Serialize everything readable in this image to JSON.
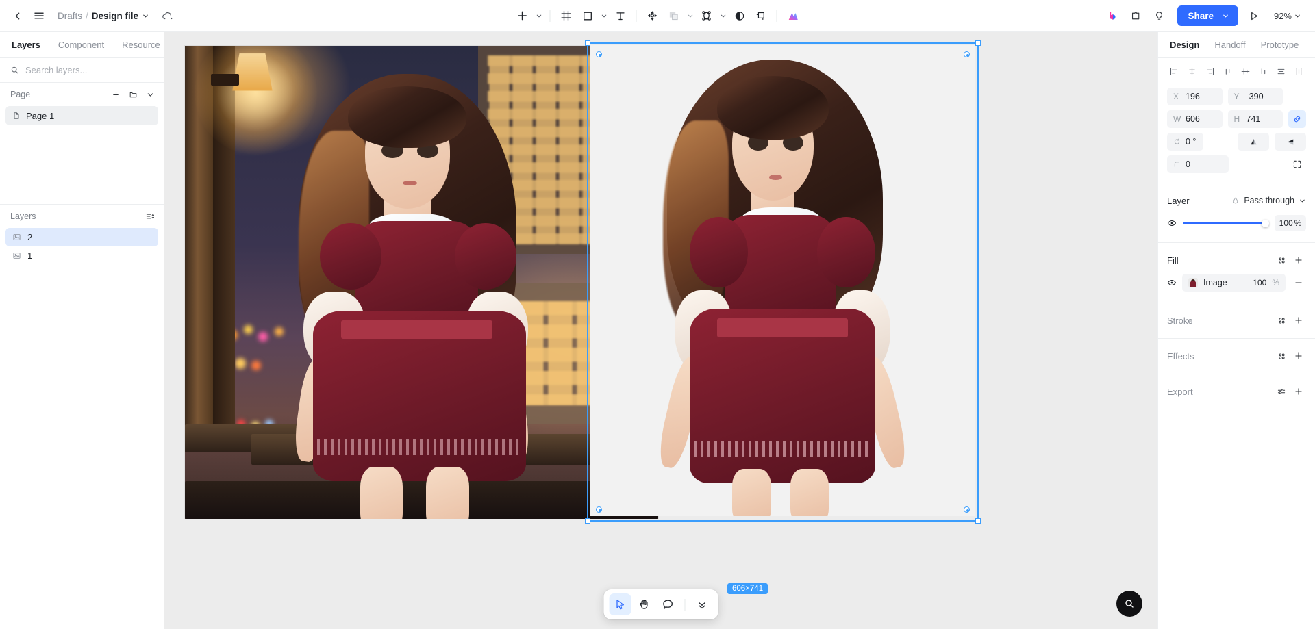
{
  "topbar": {
    "back_icon": "chevron-left-icon",
    "menu_icon": "hamburger-menu-icon",
    "breadcrumb": {
      "root": "Drafts",
      "separator": "/",
      "file": "Design file"
    },
    "cloud_icon": "cloud-saved-icon",
    "tools": [
      {
        "name": "add-icon",
        "has_caret": true
      },
      {
        "name": "frame-icon",
        "has_caret": false
      },
      {
        "name": "rectangle-icon",
        "has_caret": true
      },
      {
        "name": "text-icon",
        "has_caret": false
      },
      {
        "name": "move-transform-icon",
        "has_caret": false
      },
      {
        "name": "boolean-union-icon",
        "has_caret": true
      },
      {
        "name": "vector-node-icon",
        "has_caret": true
      },
      {
        "name": "contrast-icon",
        "has_caret": false
      },
      {
        "name": "crop-icon",
        "has_caret": false
      },
      {
        "name": "ai-magic-icon",
        "has_caret": false
      }
    ],
    "right": {
      "brand_icon": "brand-b-icon",
      "plugin_icon": "plugin-puzzle-icon",
      "idea_icon": "lightbulb-icon",
      "share_label": "Share",
      "share_caret_icon": "chevron-down-icon",
      "present_icon": "play-present-icon",
      "zoom_label": "92%",
      "zoom_caret_icon": "chevron-down-icon"
    },
    "accent_color": "#2f6bff"
  },
  "left_panel": {
    "tabs": [
      {
        "label": "Layers",
        "active": true
      },
      {
        "label": "Component",
        "active": false
      },
      {
        "label": "Resource",
        "active": false
      }
    ],
    "search": {
      "placeholder": "Search layers...",
      "value": "",
      "icon": "search-icon"
    },
    "page_section": {
      "title": "Page",
      "actions": [
        "plus-icon",
        "folder-icon",
        "chevron-down-icon"
      ],
      "items": [
        {
          "label": "Page 1",
          "icon": "page-file-icon",
          "selected": true
        }
      ]
    },
    "layers_section": {
      "title": "Layers",
      "sort_icon": "sort-list-icon",
      "items": [
        {
          "label": "2",
          "icon": "image-layer-icon",
          "selected": true
        },
        {
          "label": "1",
          "icon": "image-layer-icon",
          "selected": false
        }
      ]
    }
  },
  "canvas": {
    "background_color": "#ececec",
    "selection": {
      "size_badge": "606×741",
      "color": "#3b9dfc"
    },
    "bottom_toolbar": {
      "buttons": [
        {
          "name": "cursor-select-icon",
          "active": true
        },
        {
          "name": "hand-pan-icon",
          "active": false
        },
        {
          "name": "comment-bubble-icon",
          "active": false
        },
        {
          "name": "chevron-double-down-icon",
          "active": false
        }
      ]
    },
    "fab": {
      "icon": "search-icon"
    }
  },
  "right_panel": {
    "tabs": [
      {
        "label": "Design",
        "active": true
      },
      {
        "label": "Handoff",
        "active": false
      },
      {
        "label": "Prototype",
        "active": false
      }
    ],
    "align_buttons": [
      "align-left-icon",
      "align-horizontal-center-icon",
      "align-right-icon",
      "align-top-icon",
      "align-vertical-center-icon",
      "align-bottom-icon",
      "distribute-vertical-icon",
      "distribute-horizontal-icon"
    ],
    "properties": {
      "x": {
        "label": "X",
        "value": "196"
      },
      "y": {
        "label": "Y",
        "value": "-390"
      },
      "w": {
        "label": "W",
        "value": "606"
      },
      "h": {
        "label": "H",
        "value": "741"
      },
      "constrain_icon": "link-constrain-icon",
      "rotation": {
        "label": "rotate-icon",
        "value": "0 °"
      },
      "flip_vertical_icon": "flip-vertical-icon",
      "flip_horizontal_icon": "flip-horizontal-icon",
      "corner_radius": {
        "label": "corner-radius-icon",
        "value": "0"
      },
      "independent_corners_icon": "independent-corners-icon"
    },
    "layer_section": {
      "title": "Layer",
      "blend_icon": "blend-mode-icon",
      "blend_mode": "Pass through",
      "blend_caret_icon": "chevron-down-icon",
      "visibility_icon": "eye-icon",
      "opacity": "100",
      "opacity_unit": "%"
    },
    "fill_section": {
      "title": "Fill",
      "style_icon": "style-library-icon",
      "add_icon": "plus-icon",
      "rows": [
        {
          "visibility_icon": "eye-icon",
          "swatch": "image-thumbnail",
          "name": "Image",
          "opacity": "100",
          "unit": "%",
          "remove_icon": "minus-icon"
        }
      ]
    },
    "stroke_section": {
      "title": "Stroke",
      "style_icon": "style-library-icon",
      "add_icon": "plus-icon"
    },
    "effects_section": {
      "title": "Effects",
      "style_icon": "style-library-icon",
      "add_icon": "plus-icon"
    },
    "export_section": {
      "title": "Export",
      "settings_icon": "export-settings-icon",
      "add_icon": "plus-icon"
    }
  }
}
